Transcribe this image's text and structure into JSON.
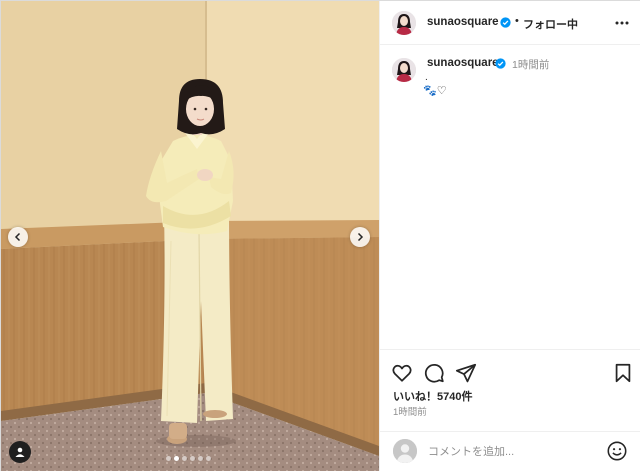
{
  "post": {
    "username": "sunaosquare",
    "follow_separator": "•",
    "follow_status": "フォロー中",
    "caption_time": "1時間前",
    "caption_line1": ".",
    "caption_line2": "🐾♡",
    "likes": "いいね！5740件",
    "posted_time": "1時間前",
    "comment_placeholder": "コメントを追加...",
    "carousel": {
      "total": 6,
      "active_index": 1
    }
  },
  "icons": {
    "verified": "verified-badge-icon",
    "more": "more-options-icon",
    "like": "heart-icon",
    "comment": "comment-icon",
    "share": "paper-plane-icon",
    "save": "bookmark-icon",
    "emoji": "smiley-icon",
    "tag": "user-tag-icon",
    "prev": "chevron-left-icon",
    "next": "chevron-right-icon"
  },
  "colors": {
    "verified_blue": "#0095f6",
    "text": "#262626",
    "secondary_text": "#8e8e8e",
    "wall_upper": "#ecd7ac",
    "wall_panel": "#b98650",
    "outfit": "#f3e9b8"
  }
}
